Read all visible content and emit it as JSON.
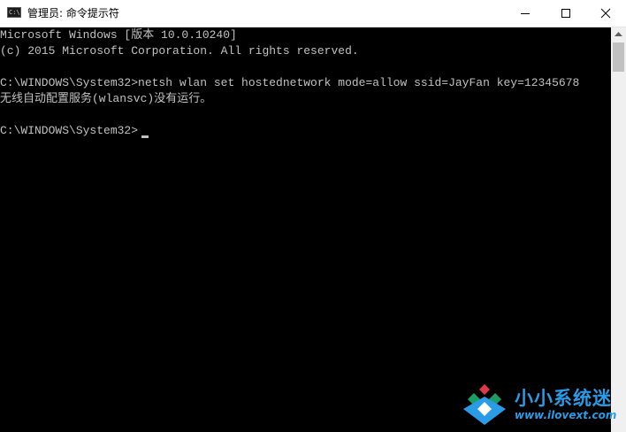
{
  "window": {
    "title": "管理员: 命令提示符",
    "icon": "cmd-icon",
    "icon_text": "C:\\",
    "controls": [
      "minimize-icon",
      "maximize-icon",
      "close-icon"
    ]
  },
  "console": {
    "lines": [
      "Microsoft Windows [版本 10.0.10240]",
      "(c) 2015 Microsoft Corporation. All rights reserved.",
      "",
      "C:\\WINDOWS\\System32>netsh wlan set hostednetwork mode=allow ssid=JayFan key=12345678",
      "无线自动配置服务(wlansvc)没有运行。",
      "",
      "C:\\WINDOWS\\System32>"
    ],
    "text_color": "#c0c0c0",
    "background": "#000000"
  },
  "watermark": {
    "name": "小小系统迷",
    "url": "www.ilovext.com",
    "color": "#2a9be6"
  }
}
